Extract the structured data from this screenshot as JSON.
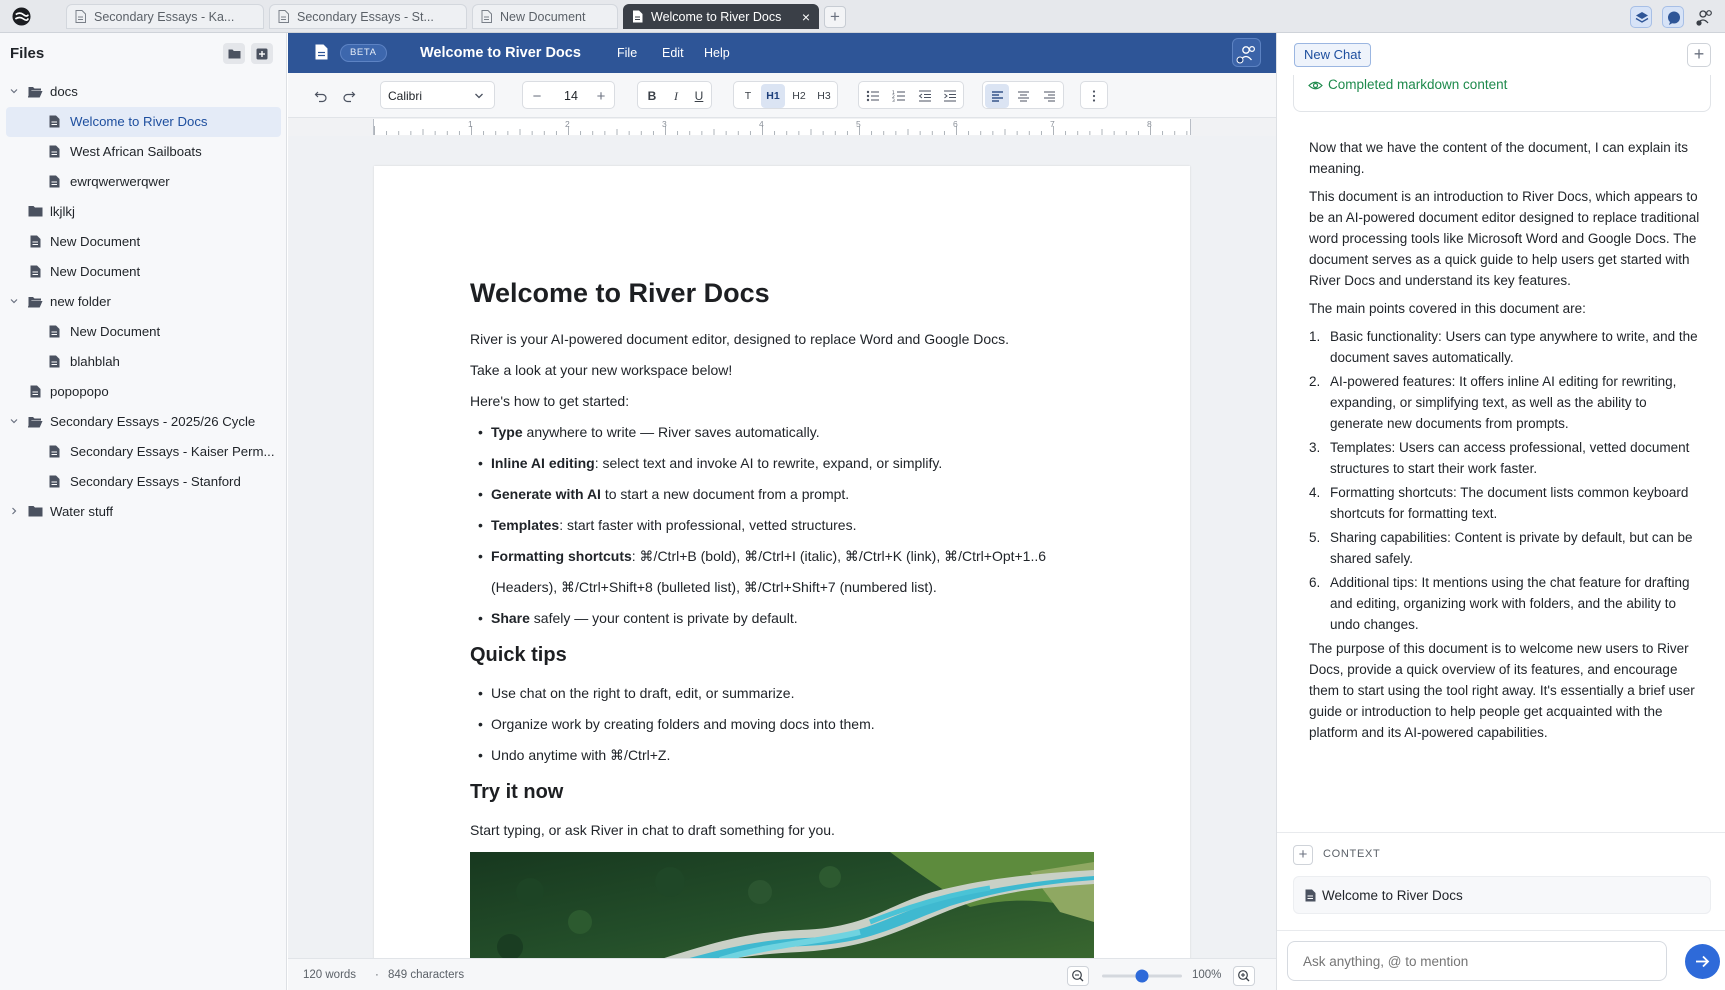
{
  "browser": {
    "tabs": [
      {
        "label": "Secondary Essays - Ka...",
        "active": false
      },
      {
        "label": "Secondary Essays - St...",
        "active": false
      },
      {
        "label": "New Document",
        "active": false
      },
      {
        "label": "Welcome to River Docs",
        "active": true
      }
    ],
    "close_glyph": "×",
    "add_glyph": "+"
  },
  "sidebar": {
    "title": "Files",
    "tree": [
      {
        "label": "docs",
        "type": "folder",
        "expanded": true,
        "depth": 0
      },
      {
        "label": "Welcome to River Docs",
        "type": "doc",
        "depth": 1,
        "selected": true
      },
      {
        "label": "West African Sailboats",
        "type": "doc",
        "depth": 1
      },
      {
        "label": "ewrqwerwerqwer",
        "type": "doc",
        "depth": 1
      },
      {
        "label": "lkjlkj",
        "type": "folder",
        "depth": 0
      },
      {
        "label": "New Document",
        "type": "doc",
        "depth": 0
      },
      {
        "label": "New Document",
        "type": "doc",
        "depth": 0
      },
      {
        "label": "new folder",
        "type": "folder",
        "expanded": true,
        "depth": 0
      },
      {
        "label": "New Document",
        "type": "doc",
        "depth": 1
      },
      {
        "label": "blahblah",
        "type": "doc",
        "depth": 1
      },
      {
        "label": "popopopo",
        "type": "doc",
        "depth": 0
      },
      {
        "label": "Secondary Essays - 2025/26 Cycle",
        "type": "folder",
        "expanded": true,
        "depth": 0
      },
      {
        "label": "Secondary Essays - Kaiser Perm...",
        "type": "doc",
        "depth": 1
      },
      {
        "label": "Secondary Essays - Stanford",
        "type": "doc",
        "depth": 1
      },
      {
        "label": "Water stuff",
        "type": "folder",
        "expanded": false,
        "depth": 0
      }
    ]
  },
  "editor": {
    "beta_label": "BETA",
    "title": "Welcome to River Docs",
    "menus": [
      "File",
      "Edit",
      "Help"
    ],
    "font": "Calibri",
    "font_size": "14",
    "minus": "−",
    "plus": "+",
    "style_buttons": [
      "T",
      "H1",
      "H2",
      "H3"
    ],
    "active_style": "H1",
    "format_buttons": [
      "B",
      "I",
      "U"
    ],
    "ruler_numbers": [
      "1",
      "2",
      "3",
      "4",
      "5",
      "6",
      "7",
      "8"
    ],
    "status": {
      "words": "120 words",
      "separator": "·",
      "characters": "849 characters",
      "zoom": "100%",
      "zoom_level": 0.5
    }
  },
  "document": {
    "h1": "Welcome to River Docs",
    "intro": "River is your AI-powered document editor, designed to replace Word and Google Docs.",
    "look": "Take a look at your new workspace below!",
    "started": "Here's how to get started:",
    "bullets": [
      {
        "bold": "Type",
        "rest": " anywhere to write — River saves automatically."
      },
      {
        "bold": "Inline AI editing",
        "rest": ": select text and invoke AI to rewrite, expand, or simplify."
      },
      {
        "bold": "Generate with AI",
        "rest": " to start a new document from a prompt."
      },
      {
        "bold": "Templates",
        "rest": ": start faster with professional, vetted structures."
      },
      {
        "bold": "Formatting shortcuts",
        "rest": ": ⌘/Ctrl+B (bold), ⌘/Ctrl+I (italic), ⌘/Ctrl+K (link), ⌘/Ctrl+Opt+1..6 (Headers), ⌘/Ctrl+Shift+8 (bulleted list), ⌘/Ctrl+Shift+7 (numbered list)."
      },
      {
        "bold": "Share",
        "rest": " safely — your content is private by default."
      }
    ],
    "h2_tips": "Quick tips",
    "tips": [
      "Use chat on the right to draft, edit, or summarize.",
      "Organize work by creating folders and moving docs into them.",
      "Undo anytime with ⌘/Ctrl+Z."
    ],
    "h2_try": "Try it now",
    "try_text": "Start typing, or ask River in chat to draft something for you."
  },
  "chat": {
    "tab_label": "New Chat",
    "status": "Completed markdown content",
    "intro": "Now that we have the content of the document, I can explain its meaning.",
    "summary": "This document is an introduction to River Docs, which appears to be an AI-powered document editor designed to replace traditional word processing tools like Microsoft Word and Google Docs. The document serves as a quick guide to help users get started with River Docs and understand its key features.",
    "points_intro": "The main points covered in this document are:",
    "points": [
      {
        "n": "1.",
        "text": "Basic functionality: Users can type anywhere to write, and the document saves automatically."
      },
      {
        "n": "2.",
        "text": "AI-powered features: It offers inline AI editing for rewriting, expanding, or simplifying text, as well as the ability to generate new documents from prompts."
      },
      {
        "n": "3.",
        "text": "Templates: Users can access professional, vetted document structures to start their work faster."
      },
      {
        "n": "4.",
        "text": "Formatting shortcuts: The document lists common keyboard shortcuts for formatting text."
      },
      {
        "n": "5.",
        "text": "Sharing capabilities: Content is private by default, but can be shared safely."
      },
      {
        "n": "6.",
        "text": "Additional tips: It mentions using the chat feature for drafting and editing, organizing work with folders, and the ability to undo changes."
      }
    ],
    "conclusion": "The purpose of this document is to welcome new users to River Docs, provide a quick overview of its features, and encourage them to start using the tool right away. It's essentially a brief user guide or introduction to help people get acquainted with the platform and its AI-powered capabilities.",
    "context_label": "CONTEXT",
    "context_doc": "Welcome to River Docs",
    "input_placeholder": "Ask anything, @ to mention"
  },
  "colors": {
    "header_blue": "#2e5597",
    "accent_blue": "#2e6ad9",
    "success_green": "#1e8a4c"
  },
  "icons": [
    "river-logo-icon",
    "document-icon",
    "folder-icon",
    "folder-open-icon",
    "chevron-down-icon",
    "chevron-right-icon",
    "undo-icon",
    "redo-icon",
    "bullet-list-icon",
    "numbered-list-icon",
    "outdent-icon",
    "indent-icon",
    "align-left-icon",
    "align-center-icon",
    "align-right-icon",
    "more-icon",
    "zoom-out-icon",
    "zoom-in-icon",
    "eye-icon",
    "send-icon",
    "share-icon",
    "layers-icon",
    "chat-icon",
    "people-icon"
  ]
}
